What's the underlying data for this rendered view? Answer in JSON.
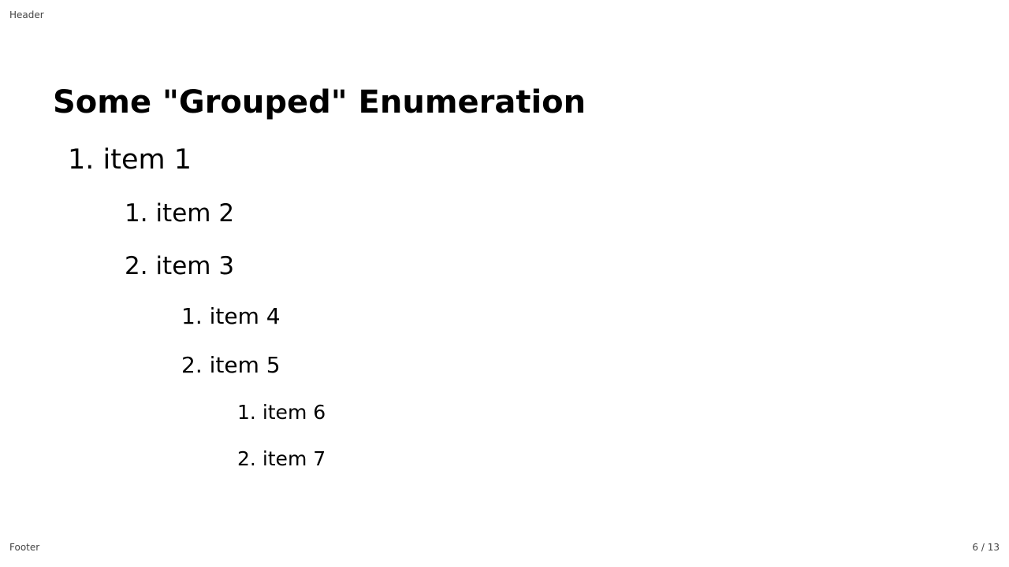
{
  "header": {
    "text": "Header"
  },
  "footer": {
    "text": "Footer"
  },
  "pagination": {
    "text": "6 / 13"
  },
  "slide": {
    "title": "Some \"Grouped\" Enumeration",
    "items": [
      {
        "num": "1.",
        "text": "item 1"
      },
      {
        "num": "1.",
        "text": "item 2"
      },
      {
        "num": "2.",
        "text": "item 3"
      },
      {
        "num": "1.",
        "text": "item 4"
      },
      {
        "num": "2.",
        "text": "item 5"
      },
      {
        "num": "1.",
        "text": "item 6"
      },
      {
        "num": "2.",
        "text": "item 7"
      }
    ]
  }
}
